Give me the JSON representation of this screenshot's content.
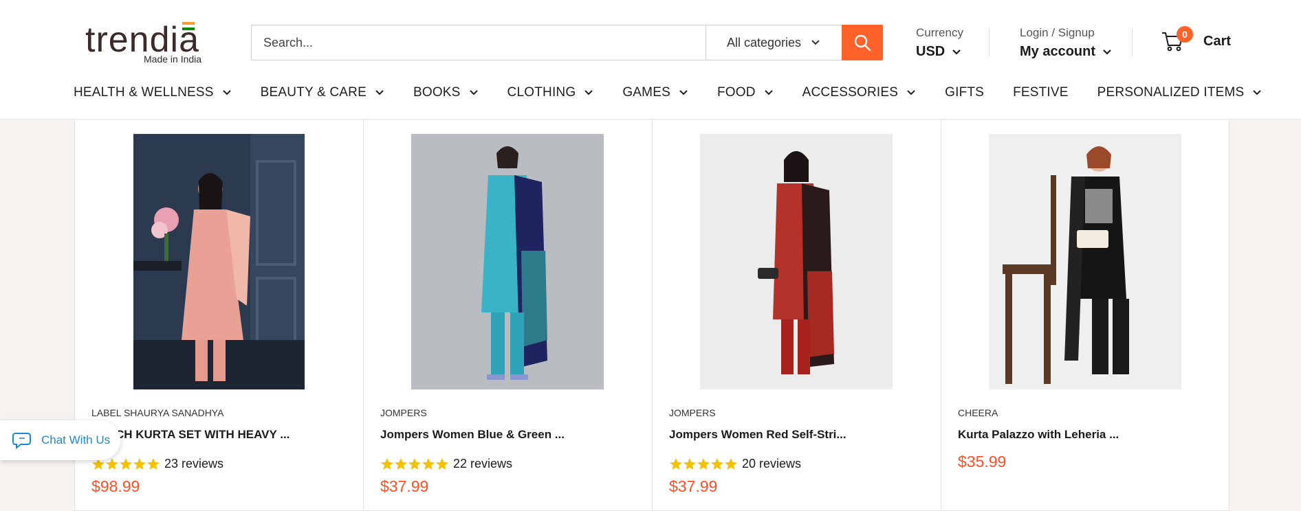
{
  "header": {
    "logo_text": "trendia",
    "logo_tagline": "Made in India",
    "search": {
      "placeholder": "Search...",
      "category": "All categories"
    },
    "currency": {
      "label": "Currency",
      "value": "USD"
    },
    "account": {
      "label": "Login / Signup",
      "value": "My account"
    },
    "cart": {
      "count": "0",
      "label": "Cart"
    },
    "accent_color": "#ff6128"
  },
  "nav": [
    {
      "label": "HEALTH & WELLNESS",
      "dropdown": true
    },
    {
      "label": "BEAUTY & CARE",
      "dropdown": true
    },
    {
      "label": "BOOKS",
      "dropdown": true
    },
    {
      "label": "CLOTHING",
      "dropdown": true
    },
    {
      "label": "GAMES",
      "dropdown": true
    },
    {
      "label": "FOOD",
      "dropdown": true
    },
    {
      "label": "ACCESSORIES",
      "dropdown": true
    },
    {
      "label": "GIFTS",
      "dropdown": false
    },
    {
      "label": "FESTIVE",
      "dropdown": false
    },
    {
      "label": "PERSONALIZED ITEMS",
      "dropdown": true
    }
  ],
  "products": [
    {
      "brand": "LABEL SHAURYA SANADHYA",
      "title": "PEACH KURTA SET WITH HEAVY ...",
      "rating": 5,
      "reviews": "23 reviews",
      "price": "$98.99"
    },
    {
      "brand": "JOMPERS",
      "title": "Jompers Women Blue & Green ...",
      "rating": 5,
      "reviews": "22 reviews",
      "price": "$37.99"
    },
    {
      "brand": "JOMPERS",
      "title": "Jompers Women Red Self-Stri...",
      "rating": 5,
      "reviews": "20 reviews",
      "price": "$37.99"
    },
    {
      "brand": "CHEERA",
      "title": "Kurta Palazzo with Leheria ...",
      "rating": null,
      "reviews": "",
      "price": "$35.99"
    }
  ],
  "chat": {
    "label": "Chat With Us"
  }
}
